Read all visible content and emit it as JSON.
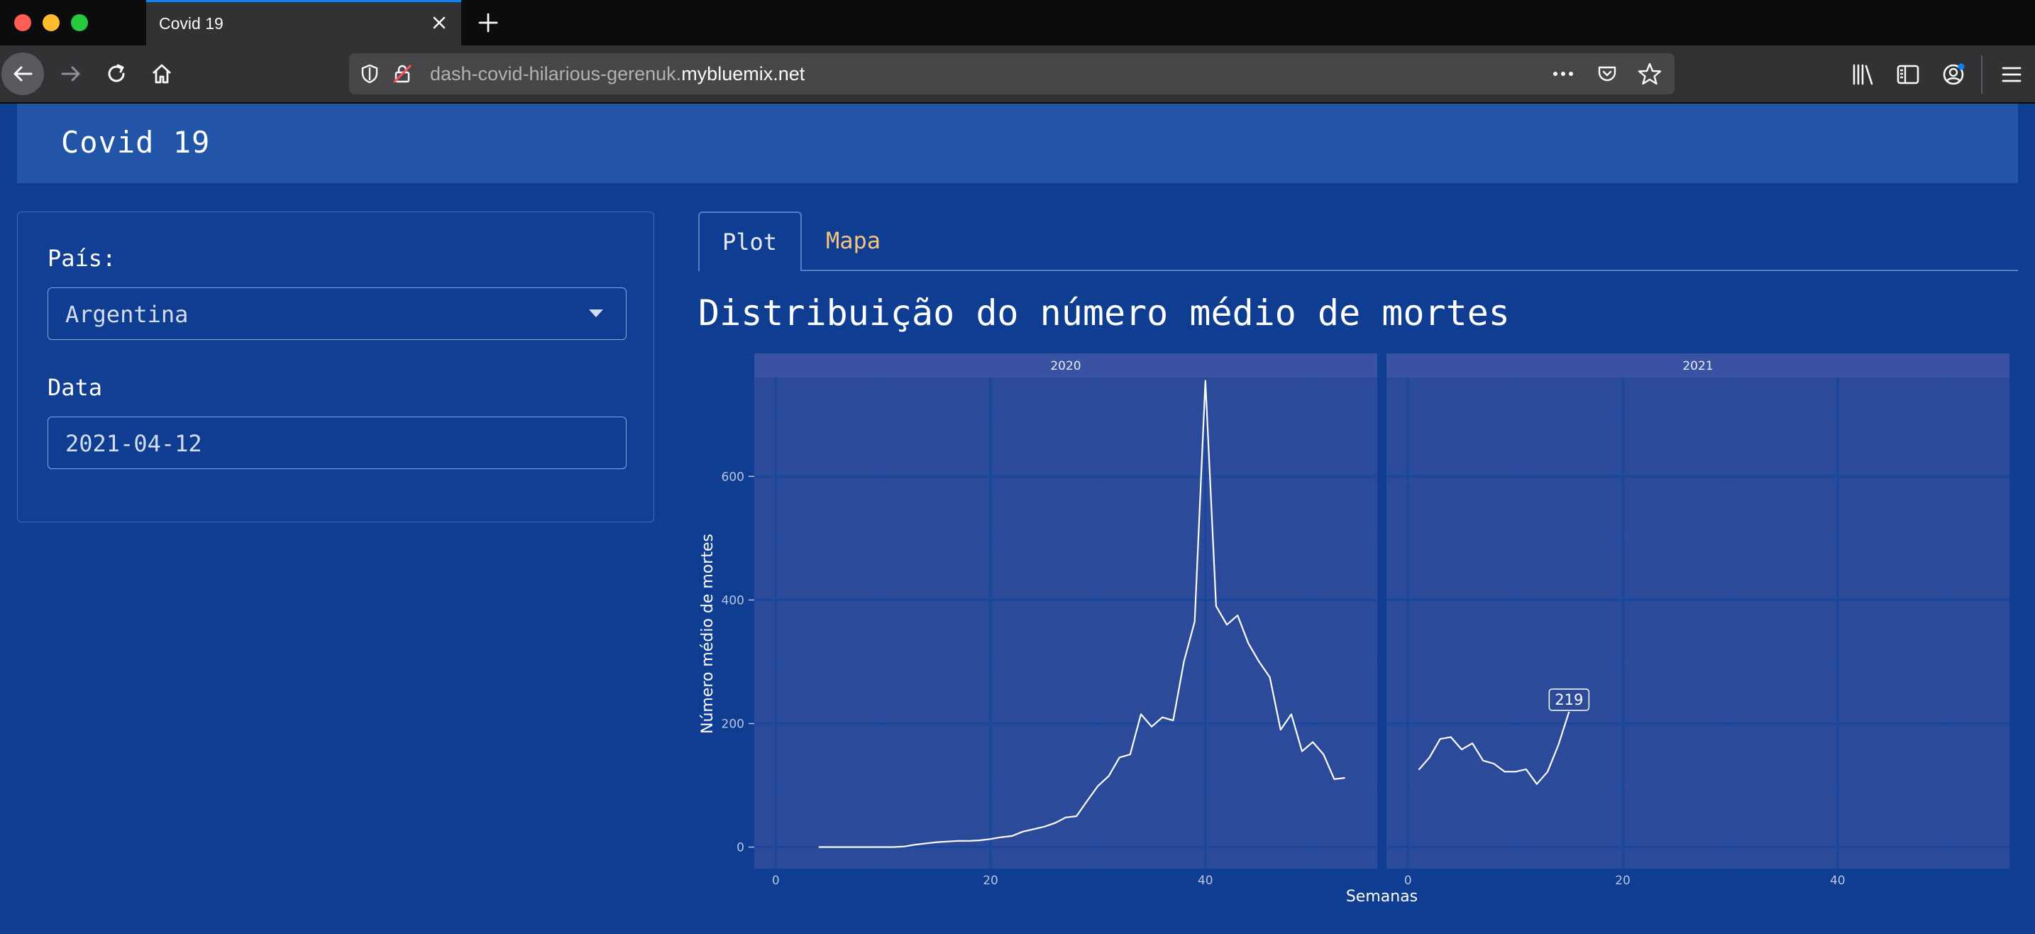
{
  "browser": {
    "tab_title": "Covid 19",
    "url_prefix": "dash-covid-hilarious-gerenuk.",
    "url_domain": "mybluemix.net"
  },
  "header": {
    "title": "Covid 19"
  },
  "sidebar": {
    "country_label": "País:",
    "country_value": "Argentina",
    "date_label": "Data",
    "date_value": "2021-04-12"
  },
  "tabs": [
    {
      "label": "Plot",
      "active": true
    },
    {
      "label": "Mapa",
      "active": false
    }
  ],
  "colors": {
    "page_bg": "#0e3d92",
    "header_bg": "#2255a8",
    "panel_bg": "#2b4a9a",
    "strip_bg": "#3a52a2",
    "line": "#ffffff",
    "inactive_tab": "#f7c37d"
  },
  "chart_data": {
    "type": "line",
    "title": "Distribuição do número médio de mortes",
    "xlabel": "Semanas",
    "ylabel": "Número médio de mortes",
    "ylim": [
      -35,
      760
    ],
    "xlim": [
      -2,
      56
    ],
    "x_ticks": [
      0,
      20,
      40
    ],
    "y_ticks": [
      0,
      200,
      400,
      600
    ],
    "grid": true,
    "legend": "none",
    "panels": [
      {
        "name": "2020",
        "x": [
          4,
          5,
          6,
          7,
          8,
          9,
          10,
          11,
          12,
          13,
          14,
          15,
          16,
          17,
          18,
          19,
          20,
          21,
          22,
          23,
          24,
          25,
          26,
          27,
          28,
          29,
          30,
          31,
          32,
          33,
          34,
          35,
          36,
          37,
          38,
          39,
          40,
          41,
          42,
          43,
          44,
          45,
          46,
          47,
          48,
          49,
          50,
          51,
          52,
          53
        ],
        "y": [
          0,
          0,
          0,
          0,
          0,
          0,
          0,
          0,
          1,
          4,
          6,
          8,
          9,
          10,
          10,
          11,
          13,
          16,
          18,
          25,
          29,
          33,
          39,
          48,
          50,
          75,
          99,
          115,
          145,
          150,
          215,
          195,
          210,
          205,
          300,
          365,
          755,
          390,
          360,
          375,
          330,
          300,
          275,
          190,
          215,
          155,
          170,
          150,
          110,
          112
        ]
      },
      {
        "name": "2021",
        "x": [
          1,
          2,
          3,
          4,
          5,
          6,
          7,
          8,
          9,
          10,
          11,
          12,
          13,
          14,
          15
        ],
        "y": [
          125,
          145,
          175,
          178,
          158,
          168,
          140,
          135,
          122,
          122,
          126,
          102,
          122,
          165,
          219
        ],
        "annotation": {
          "x": 15,
          "y": 219,
          "label": "219"
        }
      }
    ]
  }
}
